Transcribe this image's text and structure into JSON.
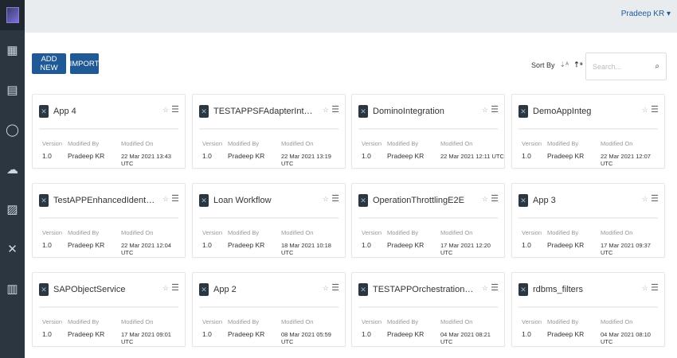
{
  "header": {
    "user": "Pradeep KR"
  },
  "sidebar": {
    "items": [
      "dashboard-icon",
      "api-icon",
      "chat-icon",
      "cloud-icon",
      "analytics-icon",
      "tools-icon",
      "device-icon"
    ]
  },
  "toolbar": {
    "add_new": "ADD NEW",
    "import": "IMPORT",
    "sort_by": "Sort By",
    "search_placeholder": "Search..."
  },
  "labels": {
    "version": "Version",
    "modified_by": "Modified By",
    "modified_on": "Modified On"
  },
  "cards": [
    {
      "title": "App 4",
      "version": "1.0",
      "by": "Pradeep KR",
      "on": "22 Mar 2021 13:43 UTC"
    },
    {
      "title": "TESTAPPSFAdapterIntegrationWit...",
      "version": "1.0",
      "by": "Pradeep KR",
      "on": "22 Mar 2021 13:19 UTC"
    },
    {
      "title": "DominoIntegration",
      "version": "1.0",
      "by": "Pradeep KR",
      "on": "22 Mar 2021 12:11 UTC"
    },
    {
      "title": "DemoAppInteg",
      "version": "1.0",
      "by": "Pradeep KR",
      "on": "22 Mar 2021 12:07 UTC"
    },
    {
      "title": "TestAPPEnhancedIdentityIntegration",
      "version": "1.0",
      "by": "Pradeep KR",
      "on": "22 Mar 2021 12:04 UTC"
    },
    {
      "title": "Loan Workflow",
      "version": "1.0",
      "by": "Pradeep KR",
      "on": "18 Mar 2021 10:18 UTC"
    },
    {
      "title": "OperationThrottlingE2E",
      "version": "1.0",
      "by": "Pradeep KR",
      "on": "17 Mar 2021 12:20 UTC"
    },
    {
      "title": "App 3",
      "version": "1.0",
      "by": "Pradeep KR",
      "on": "17 Mar 2021 09:37 UTC"
    },
    {
      "title": "SAPObjectService",
      "version": "1.0",
      "by": "Pradeep KR",
      "on": "17 Mar 2021 09:01 UTC"
    },
    {
      "title": "App 2",
      "version": "1.0",
      "by": "Pradeep KR",
      "on": "08 Mar 2021 05:59 UTC"
    },
    {
      "title": "TESTAPPOrchestrationOverObject...",
      "version": "1.0",
      "by": "Pradeep KR",
      "on": "04 Mar 2021 08:21 UTC"
    },
    {
      "title": "rdbms_filters",
      "version": "1.0",
      "by": "Pradeep KR",
      "on": "04 Mar 2021 08:10 UTC"
    }
  ]
}
